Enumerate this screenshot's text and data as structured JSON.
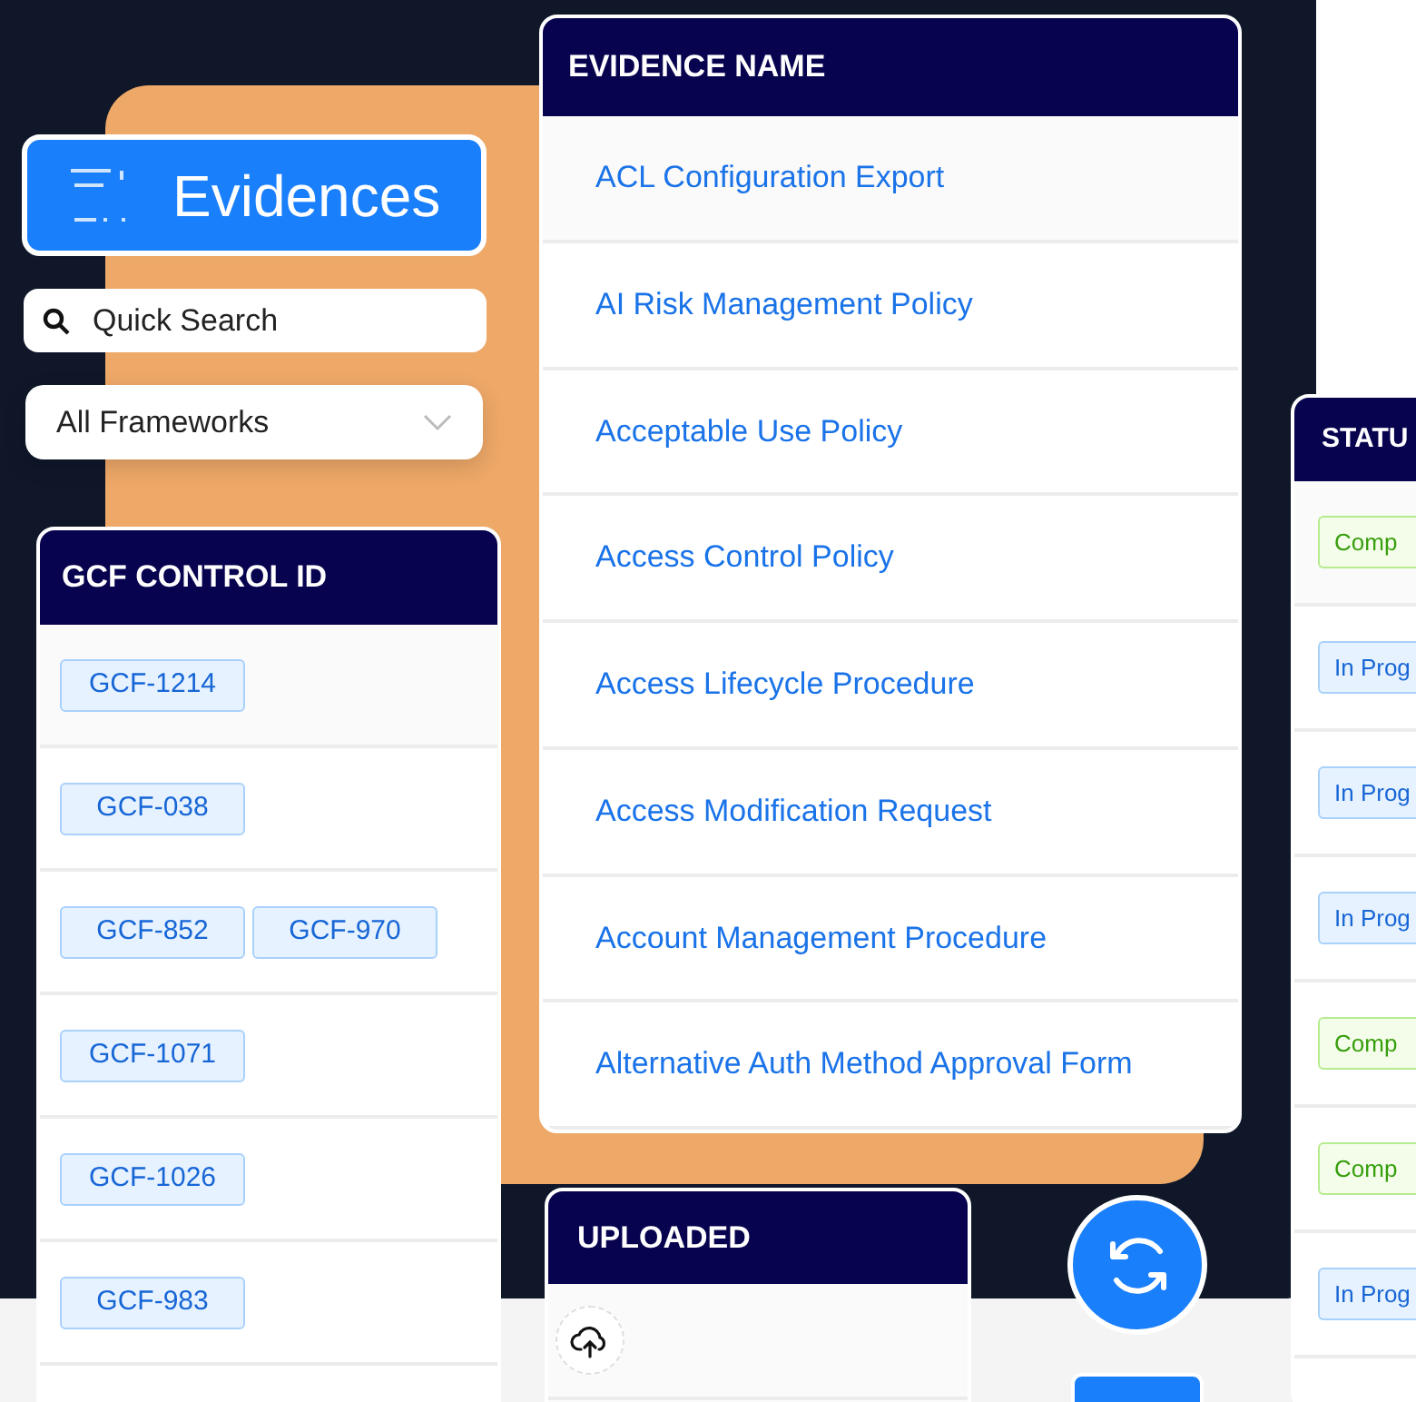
{
  "header": {
    "title": "Evidences"
  },
  "search": {
    "placeholder": "Quick Search"
  },
  "framework_select": {
    "value": "All Frameworks"
  },
  "controls_table": {
    "heading": "GCF CONTROL ID",
    "rows": [
      {
        "ids": [
          "GCF-1214"
        ]
      },
      {
        "ids": [
          "GCF-038"
        ]
      },
      {
        "ids": [
          "GCF-852",
          "GCF-970"
        ]
      },
      {
        "ids": [
          "GCF-1071"
        ]
      },
      {
        "ids": [
          "GCF-1026"
        ]
      },
      {
        "ids": [
          "GCF-983"
        ]
      }
    ]
  },
  "evidence_table": {
    "heading": "EVIDENCE NAME",
    "rows": [
      "ACL Configuration Export",
      "AI Risk Management Policy",
      "Acceptable Use Policy",
      "Access Control Policy",
      "Access Lifecycle Procedure",
      "Access Modification Request",
      "Account Management Procedure",
      "Alternative Auth Method Approval Form"
    ]
  },
  "status_table": {
    "heading": "STATU",
    "rows": [
      {
        "label": "Comp",
        "kind": "complete"
      },
      {
        "label": "In Prog",
        "kind": "progress"
      },
      {
        "label": "In Prog",
        "kind": "progress"
      },
      {
        "label": "In Prog",
        "kind": "progress"
      },
      {
        "label": "Comp",
        "kind": "complete"
      },
      {
        "label": "Comp",
        "kind": "complete"
      },
      {
        "label": "In Prog",
        "kind": "progress"
      }
    ]
  },
  "uploaded_table": {
    "heading": "UPLOADED"
  }
}
